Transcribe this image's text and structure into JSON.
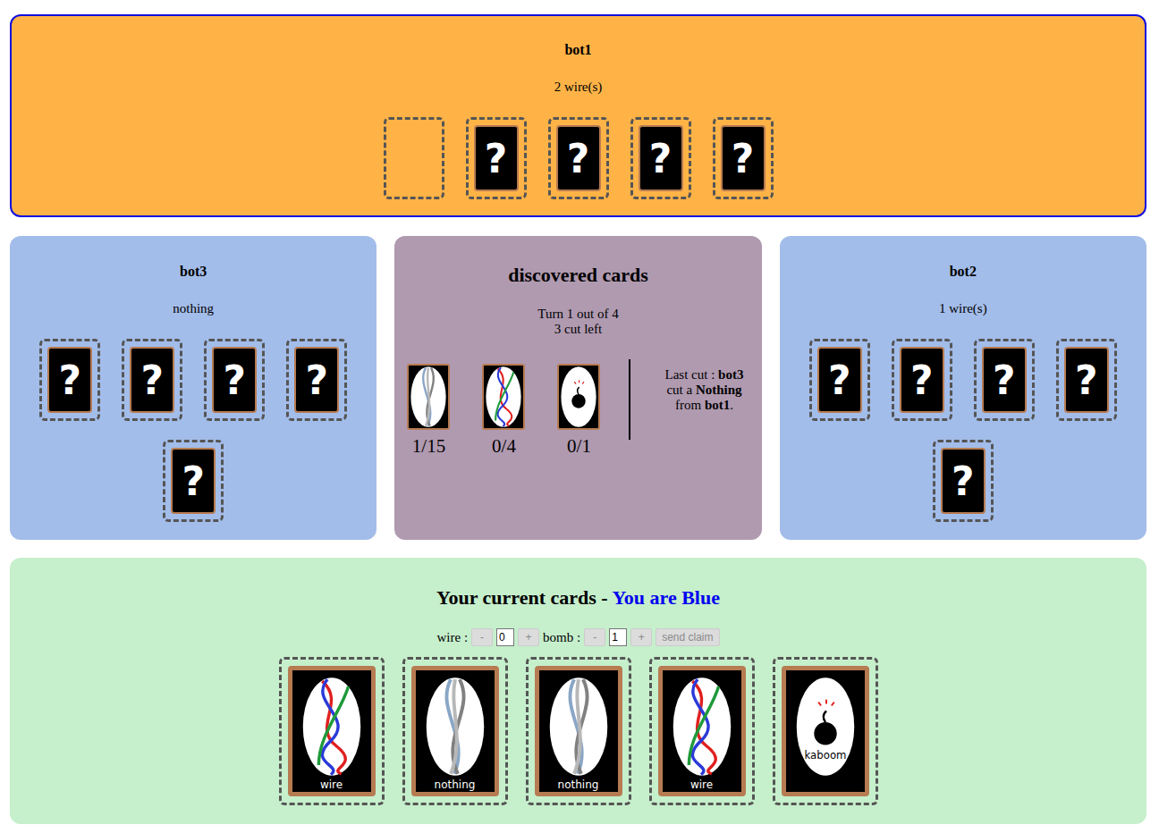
{
  "hidden_card_mark": "?",
  "top_player": {
    "name": "bot1",
    "summary": "2 wire(s)",
    "active": true,
    "cards": [
      {
        "kind": "empty"
      },
      {
        "kind": "hidden"
      },
      {
        "kind": "hidden"
      },
      {
        "kind": "hidden"
      },
      {
        "kind": "hidden"
      }
    ]
  },
  "left_player": {
    "name": "bot3",
    "summary": "nothing",
    "active": false,
    "cards": [
      {
        "kind": "hidden"
      },
      {
        "kind": "hidden"
      },
      {
        "kind": "hidden"
      },
      {
        "kind": "hidden"
      },
      {
        "kind": "hidden"
      }
    ]
  },
  "right_player": {
    "name": "bot2",
    "summary": "1 wire(s)",
    "active": false,
    "cards": [
      {
        "kind": "hidden"
      },
      {
        "kind": "hidden"
      },
      {
        "kind": "hidden"
      },
      {
        "kind": "hidden"
      },
      {
        "kind": "hidden"
      }
    ]
  },
  "discovered": {
    "title": "discovered cards",
    "turn": "Turn 1 out of 4",
    "cuts_left": "3 cut left",
    "counts": [
      {
        "kind": "nothing",
        "count": "1/15"
      },
      {
        "kind": "wire",
        "count": "0/4"
      },
      {
        "kind": "bomb",
        "count": "0/1"
      }
    ],
    "last_cut": [
      {
        "text": "Last cut : ",
        "bold": false
      },
      {
        "text": "bot3",
        "bold": true
      },
      {
        "text": " cut a ",
        "bold": false
      },
      {
        "text": "Nothing",
        "bold": true
      },
      {
        "text": " from ",
        "bold": false
      },
      {
        "text": "bot1",
        "bold": true
      },
      {
        "text": ".",
        "bold": false
      }
    ]
  },
  "hand": {
    "title": "Your current cards - ",
    "team": {
      "text": "You are Blue",
      "color": "#0000ee"
    },
    "claim": {
      "wire_label": "wire :",
      "wire_value": "0",
      "bomb_label": "bomb :",
      "bomb_value": "1",
      "minus": "-",
      "plus": "+",
      "button": "send claim",
      "disabled": true
    },
    "cards": [
      {
        "kind": "wire",
        "label": "wire"
      },
      {
        "kind": "nothing",
        "label": "nothing"
      },
      {
        "kind": "nothing",
        "label": "nothing"
      },
      {
        "kind": "wire",
        "label": "wire"
      },
      {
        "kind": "bomb",
        "label": "kaboom"
      }
    ]
  }
}
